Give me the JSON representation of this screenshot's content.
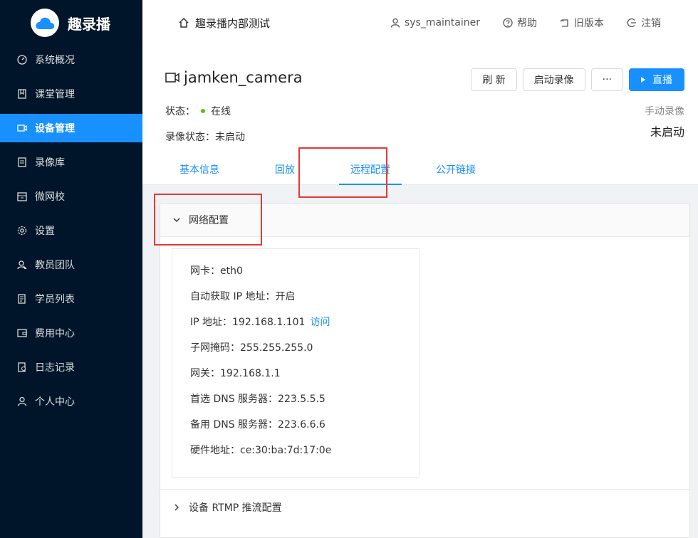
{
  "app": {
    "name": "趣录播"
  },
  "sidebar": {
    "items": [
      {
        "label": "系统概况",
        "icon": "dashboard-icon"
      },
      {
        "label": "课堂管理",
        "icon": "book-icon"
      },
      {
        "label": "设备管理",
        "icon": "video-camera-icon",
        "active": true
      },
      {
        "label": "录像库",
        "icon": "file-icon"
      },
      {
        "label": "微网校",
        "icon": "school-icon"
      },
      {
        "label": "设置",
        "icon": "gear-icon"
      },
      {
        "label": "教员团队",
        "icon": "team-icon"
      },
      {
        "label": "学员列表",
        "icon": "list-icon"
      },
      {
        "label": "费用中心",
        "icon": "wallet-icon"
      },
      {
        "label": "日志记录",
        "icon": "log-icon"
      },
      {
        "label": "个人中心",
        "icon": "user-icon"
      }
    ]
  },
  "header": {
    "title": "趣录播内部测试",
    "user": "sys_maintainer",
    "help": "帮助",
    "old_version": "旧版本",
    "logout": "注销"
  },
  "device": {
    "name": "jamken_camera",
    "status_label": "状态：",
    "status_value": "在线",
    "rec_status": "录像状态：未启动",
    "manual_rec_label": "手动录像",
    "manual_rec_value": "未启动",
    "buttons": {
      "refresh": "刷 新",
      "start_rec": "启动录像",
      "more": "···",
      "live": "直播"
    }
  },
  "tabs": [
    {
      "label": "基本信息"
    },
    {
      "label": "回放"
    },
    {
      "label": "远程配置",
      "active": true
    },
    {
      "label": "公开链接"
    }
  ],
  "network": {
    "title": "网络配置",
    "lines": {
      "nic": "网卡：eth0",
      "dhcp": "自动获取 IP 地址：开启",
      "ip": "IP 地址：192.168.1.101",
      "ip_link": "访问",
      "mask": "子网掩码：255.255.255.0",
      "gateway": "网关：192.168.1.1",
      "dns1": "首选 DNS 服务器：223.5.5.5",
      "dns2": "备用 DNS 服务器：223.6.6.6",
      "mac": "硬件地址：ce:30:ba:7d:17:0e"
    }
  },
  "rtmp": {
    "title": "设备 RTMP 推流配置"
  },
  "colors": {
    "primary": "#1890ff",
    "sidebar": "#001529",
    "online": "#52c41a",
    "highlight": "#e53935"
  }
}
